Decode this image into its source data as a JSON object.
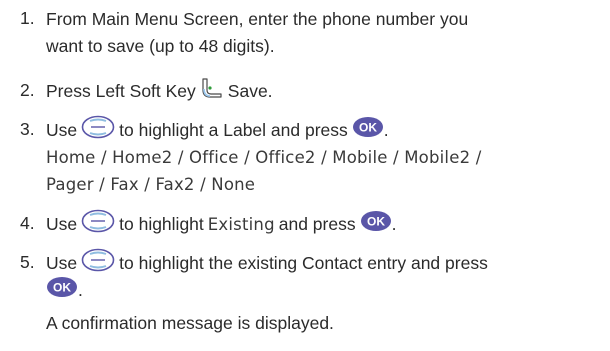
{
  "steps": [
    {
      "num": "1.",
      "line1": "From Main Menu Screen, enter the phone number you",
      "line2": "want to save (up to 48 digits)."
    },
    {
      "num": "2.",
      "pre": "Press Left Soft Key",
      "icon": "left-soft-key-icon",
      "post": "Save."
    },
    {
      "num": "3.",
      "pre": "Use",
      "icon1": "navigation-key-icon",
      "mid": "to highlight a Label and press",
      "icon2": "ok-key-icon",
      "ok_label": "OK",
      "end": ".",
      "options_line1": "Home / Home2 / Office / Office2 / Mobile / Mobile2 /",
      "options_line2": "Pager / Fax / Fax2 / None"
    },
    {
      "num": "4.",
      "pre": "Use",
      "icon1": "navigation-key-icon",
      "mid": "to highlight",
      "ui_word": "Existing",
      "post": "and press",
      "icon2": "ok-key-icon",
      "ok_label": "OK",
      "end": "."
    },
    {
      "num": "5.",
      "pre": "Use",
      "icon1": "navigation-key-icon",
      "mid": "to highlight the existing Contact entry and press",
      "icon2": "ok-key-icon",
      "ok_label": "OK",
      "end": ".",
      "note": "A confirmation message is displayed."
    }
  ],
  "colors": {
    "text": "#2b2b2b",
    "ok_key_fill": "#5a56a8",
    "nav_key_stroke": "#5a56a8"
  }
}
